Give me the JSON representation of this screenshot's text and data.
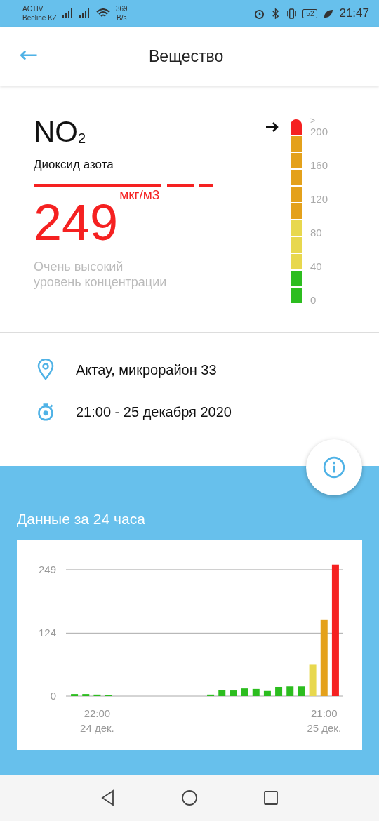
{
  "status_bar": {
    "carrier": "ACTIV",
    "network": "Beeline KZ",
    "speed_value": "369",
    "speed_unit": "B/s",
    "battery": "52",
    "time": "21:47"
  },
  "header": {
    "back": "←",
    "title": "Вещество"
  },
  "substance": {
    "formula": "NO$_{2}$",
    "name": "Диоксид азота",
    "value": "249",
    "unit": "мкг/м3",
    "description": "Очень высокий уровень концентрации"
  },
  "scale": {
    "labels": [
      ">",
      "200",
      "160",
      "120",
      "80",
      "40",
      "0"
    ],
    "segments": [
      {
        "color": "#f52121"
      },
      {
        "color": "#e4a11b"
      },
      {
        "color": "#e4a11b"
      },
      {
        "color": "#e4a11b"
      },
      {
        "color": "#e4a11b"
      },
      {
        "color": "#e4a11b"
      },
      {
        "color": "#e8d84e"
      },
      {
        "color": "#e8d84e"
      },
      {
        "color": "#e8d84e"
      },
      {
        "color": "#2cbd1f"
      },
      {
        "color": "#2cbd1f"
      }
    ]
  },
  "location": "Актау, микрорайон 33",
  "time": "21:00 - 25 декабря 2020",
  "history": {
    "title": "Данные за 24 часа",
    "chart_data": {
      "type": "bar",
      "categories": [
        null,
        null,
        "22:00\n24 дек.",
        null,
        null,
        null,
        null,
        null,
        null,
        null,
        null,
        null,
        null,
        null,
        null,
        null,
        null,
        null,
        null,
        null,
        null,
        null,
        "21:00\n25 дек.",
        null
      ],
      "values": [
        4,
        4,
        3,
        2,
        null,
        null,
        null,
        null,
        null,
        null,
        null,
        null,
        3,
        12,
        11,
        15,
        14,
        10,
        18,
        19,
        19,
        63,
        151,
        259
      ],
      "colors": [
        "#2cbd1f",
        "#2cbd1f",
        "#2cbd1f",
        "#2cbd1f",
        null,
        null,
        null,
        null,
        null,
        null,
        null,
        null,
        "#2cbd1f",
        "#2cbd1f",
        "#2cbd1f",
        "#2cbd1f",
        "#2cbd1f",
        "#2cbd1f",
        "#2cbd1f",
        "#2cbd1f",
        "#2cbd1f",
        "#e8d84e",
        "#e4a11b",
        "#f52121"
      ],
      "ylim": [
        0,
        260
      ],
      "yticks": [
        0,
        124,
        249
      ]
    }
  }
}
